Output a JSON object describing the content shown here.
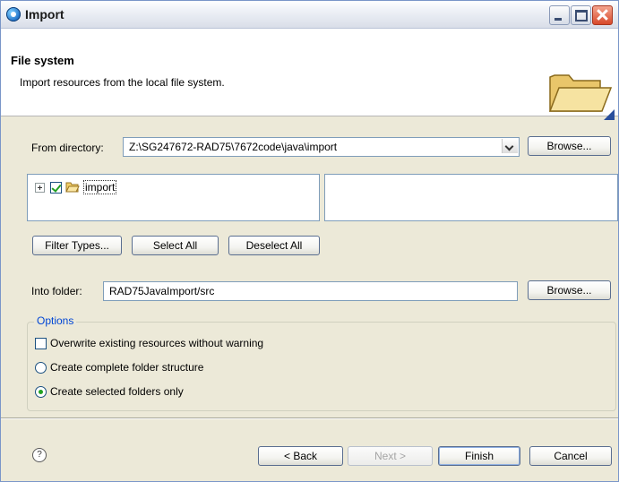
{
  "window": {
    "title": "Import"
  },
  "banner": {
    "title": "File system",
    "description": "Import resources from the local file system.",
    "icon": "folder-icon"
  },
  "source": {
    "from_directory_label": "From directory:",
    "from_directory_value": "Z:\\SG247672-RAD75\\7672code\\java\\import",
    "browse_label": "Browse..."
  },
  "tree": {
    "items": [
      {
        "label": "import",
        "checked": true,
        "expandable": true,
        "icon": "folder-icon"
      }
    ]
  },
  "selection_buttons": {
    "filter_types": "Filter Types...",
    "select_all": "Select All",
    "deselect_all": "Deselect All"
  },
  "destination": {
    "into_folder_label": "Into folder:",
    "into_folder_value": "RAD75JavaImport/src",
    "browse_label": "Browse..."
  },
  "options": {
    "legend": "Options",
    "overwrite": {
      "label": "Overwrite existing resources without warning",
      "checked": false
    },
    "complete_structure": {
      "label": "Create complete folder structure",
      "selected": false
    },
    "selected_only": {
      "label": "Create selected folders only",
      "selected": true
    }
  },
  "footer": {
    "help_icon": "help-icon",
    "help_glyph": "?",
    "back": "< Back",
    "next": "Next >",
    "finish": "Finish",
    "cancel": "Cancel"
  },
  "colors": {
    "accent": "#0046d5",
    "dialog_bg": "#ece9d8",
    "check_green": "#21a121"
  }
}
